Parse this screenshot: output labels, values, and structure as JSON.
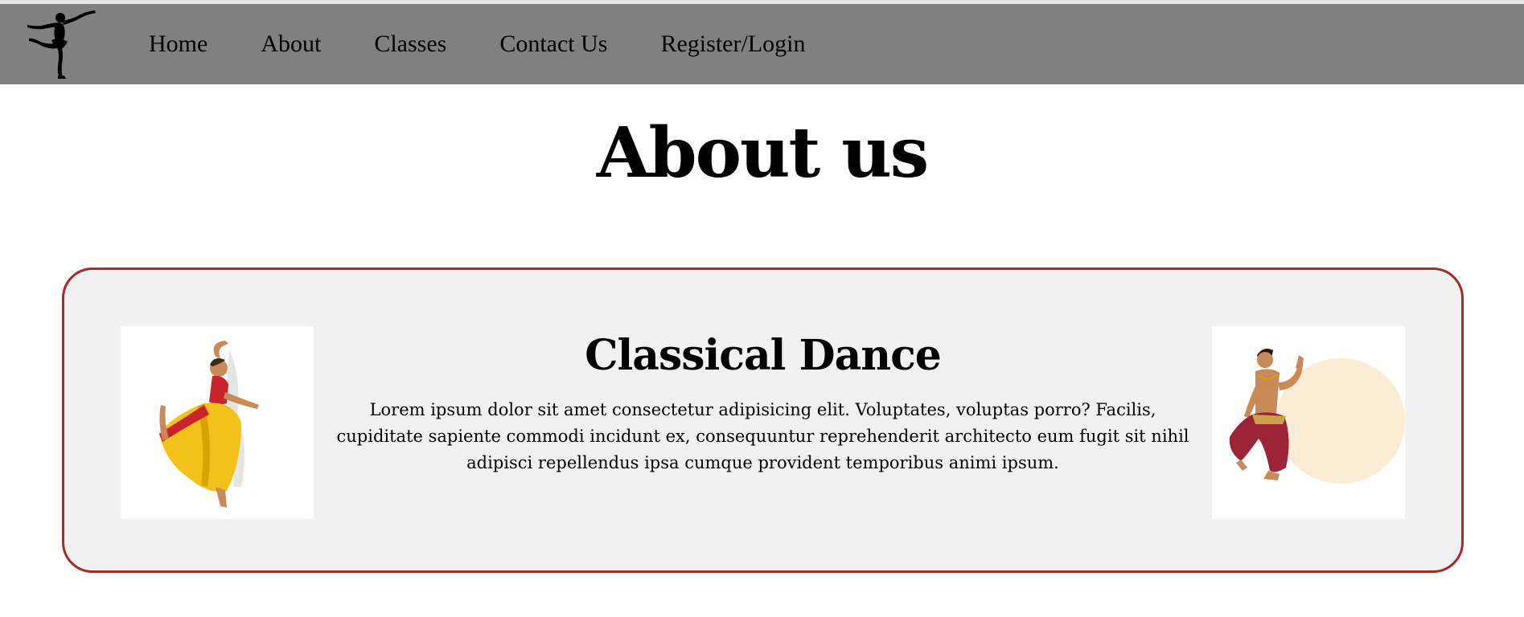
{
  "nav": {
    "items": [
      {
        "label": "Home"
      },
      {
        "label": "About"
      },
      {
        "label": "Classes"
      },
      {
        "label": "Contact Us"
      },
      {
        "label": "Register/Login"
      }
    ]
  },
  "page": {
    "title": "About us"
  },
  "card": {
    "heading": "Classical Dance",
    "text": "Lorem ipsum dolor sit amet consectetur adipisicing elit. Voluptates, voluptas porro? Facilis, cupiditate sapiente commodi incidunt ex, consequuntur reprehenderit architecto eum fugit sit nihil adipisci repellendus ipsa cumque provident temporibus animi ipsum."
  },
  "colors": {
    "navbar_bg": "#808080",
    "card_border": "#a52a2a",
    "card_bg": "#f1f1f1"
  },
  "icons": {
    "logo": "ballerina-silhouette-icon"
  }
}
